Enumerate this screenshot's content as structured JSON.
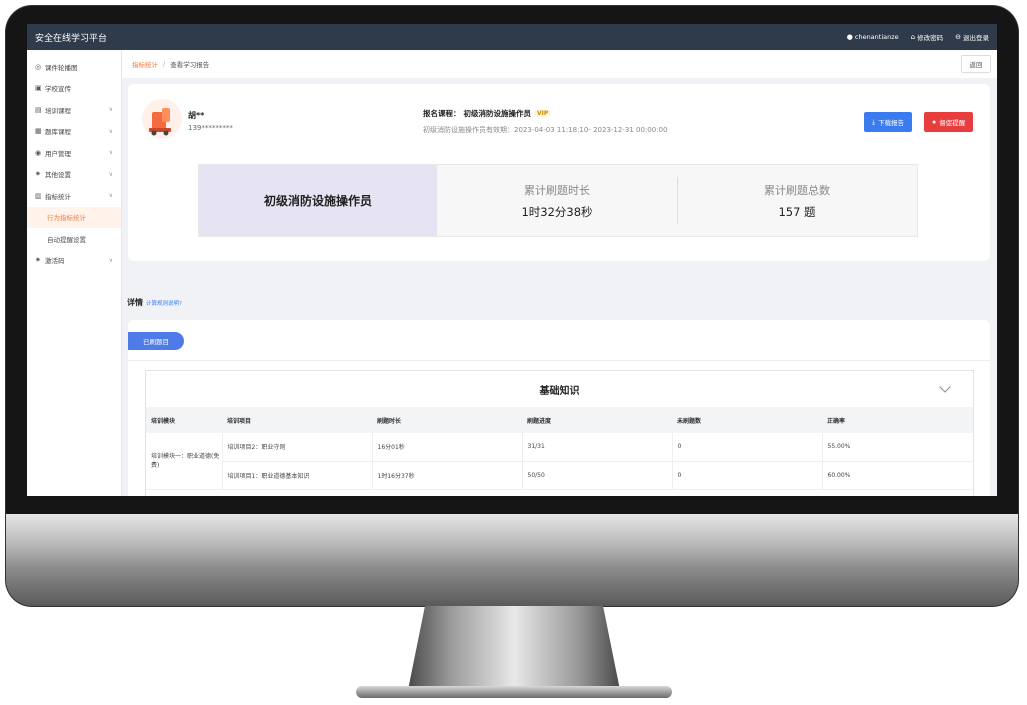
{
  "app": {
    "title": "安全在线学习平台"
  },
  "topbar": {
    "user": "chenantianze",
    "change_password": "修改密码",
    "logout": "退出登录"
  },
  "sidebar": {
    "items": [
      {
        "label": "课件轮播图",
        "icon": "bullseye-icon",
        "chevron": false
      },
      {
        "label": "学校宣传",
        "icon": "briefcase-icon",
        "chevron": false
      },
      {
        "label": "培训课程",
        "icon": "book-icon",
        "chevron": true
      },
      {
        "label": "题库课程",
        "icon": "grid-icon",
        "chevron": true
      },
      {
        "label": "用户管理",
        "icon": "user-icon",
        "chevron": true
      },
      {
        "label": "其他设置",
        "icon": "gear-icon",
        "chevron": true
      },
      {
        "label": "指标统计",
        "icon": "document-icon",
        "chevron": true
      },
      {
        "label": "行为指标统计",
        "sub": true,
        "active": true
      },
      {
        "label": "自动提醒设置",
        "sub": true
      },
      {
        "label": "激活码",
        "icon": "gear-icon",
        "chevron": true
      }
    ]
  },
  "breadcrumb": {
    "parent": "指标统计",
    "current": "查看学习报告"
  },
  "back_button": "返回",
  "learner": {
    "name": "胡**",
    "phone": "139*********"
  },
  "course": {
    "prefix": "报名课程：",
    "name": "初级消防设施操作员",
    "badge": "VIP",
    "validity": "初级消防设施操作员有效期：2023-04-03 11:18:10- 2023-12-31 00:00:00"
  },
  "buttons": {
    "download": "下载报告",
    "remind": "督促提醒"
  },
  "stats": {
    "course_name": "初级消防设施操作员",
    "total_time_label": "累计刷题时长",
    "total_time_value": "1时32分38秒",
    "total_count_label": "累计刷题总数",
    "total_count_value": "157 题"
  },
  "detail": {
    "title": "详情",
    "link": "计算规则说明?"
  },
  "tab": {
    "label": "已刷题目"
  },
  "section": {
    "title": "基础知识",
    "columns": [
      "培训模块",
      "培训项目",
      "刷题时长",
      "刷题进度",
      "未刷题数",
      "正确率"
    ],
    "module": "培训模块一：职业道德(免费)",
    "rows": [
      {
        "project": "培训项目2：职业守则",
        "time": "16分01秒",
        "progress": "31/31",
        "remaining": "0",
        "accuracy": "55.00%"
      },
      {
        "project": "培训项目1：职业道德基本知识",
        "time": "1时16分37秒",
        "progress": "50/50",
        "remaining": "0",
        "accuracy": "60.00%"
      }
    ]
  },
  "colors": {
    "accent": "#f07a3c",
    "primary": "#3a7bf0",
    "danger": "#e83d3d",
    "topbar": "#2f3a4b"
  }
}
